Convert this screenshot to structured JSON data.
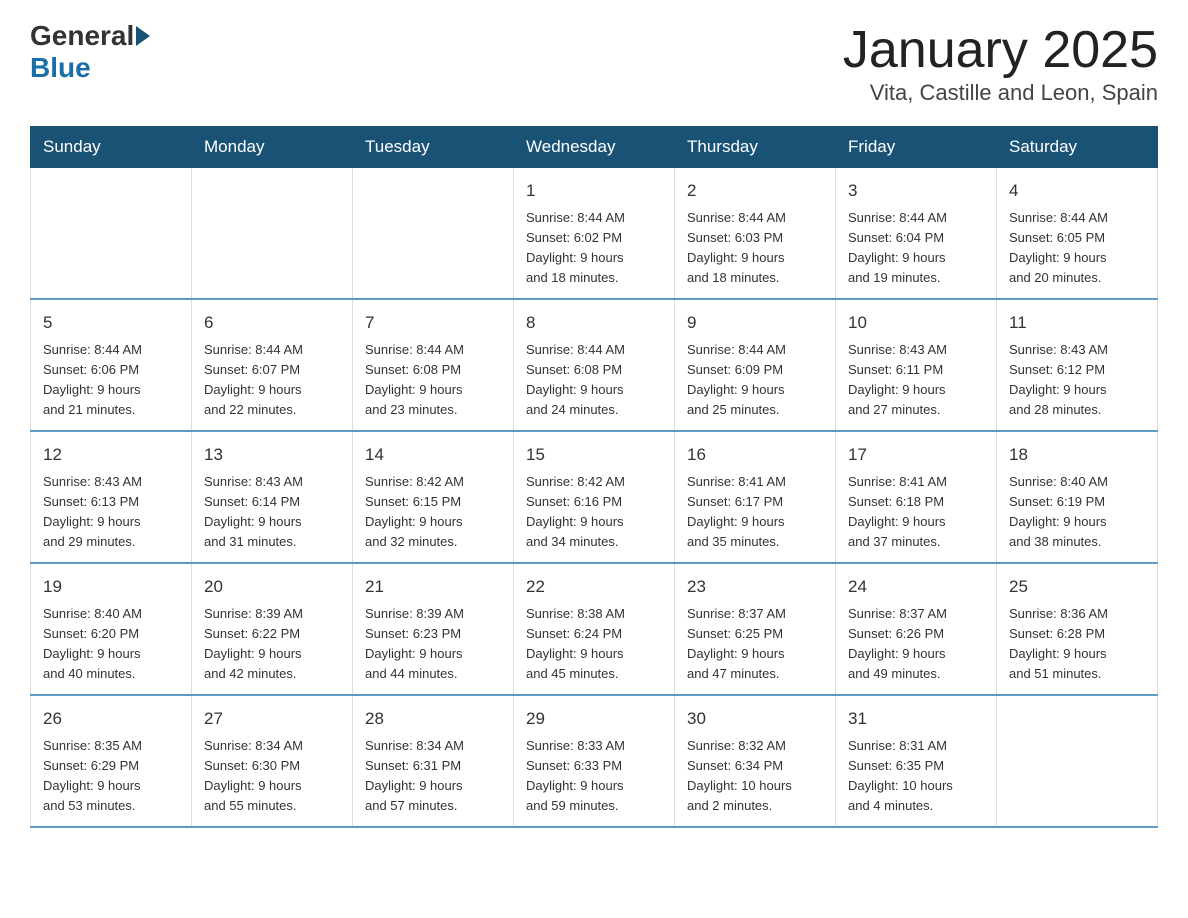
{
  "header": {
    "logo": {
      "general": "General",
      "blue": "Blue"
    },
    "title": "January 2025",
    "location": "Vita, Castille and Leon, Spain"
  },
  "weekdays": [
    "Sunday",
    "Monday",
    "Tuesday",
    "Wednesday",
    "Thursday",
    "Friday",
    "Saturday"
  ],
  "weeks": [
    [
      {
        "day": "",
        "info": ""
      },
      {
        "day": "",
        "info": ""
      },
      {
        "day": "",
        "info": ""
      },
      {
        "day": "1",
        "info": "Sunrise: 8:44 AM\nSunset: 6:02 PM\nDaylight: 9 hours\nand 18 minutes."
      },
      {
        "day": "2",
        "info": "Sunrise: 8:44 AM\nSunset: 6:03 PM\nDaylight: 9 hours\nand 18 minutes."
      },
      {
        "day": "3",
        "info": "Sunrise: 8:44 AM\nSunset: 6:04 PM\nDaylight: 9 hours\nand 19 minutes."
      },
      {
        "day": "4",
        "info": "Sunrise: 8:44 AM\nSunset: 6:05 PM\nDaylight: 9 hours\nand 20 minutes."
      }
    ],
    [
      {
        "day": "5",
        "info": "Sunrise: 8:44 AM\nSunset: 6:06 PM\nDaylight: 9 hours\nand 21 minutes."
      },
      {
        "day": "6",
        "info": "Sunrise: 8:44 AM\nSunset: 6:07 PM\nDaylight: 9 hours\nand 22 minutes."
      },
      {
        "day": "7",
        "info": "Sunrise: 8:44 AM\nSunset: 6:08 PM\nDaylight: 9 hours\nand 23 minutes."
      },
      {
        "day": "8",
        "info": "Sunrise: 8:44 AM\nSunset: 6:08 PM\nDaylight: 9 hours\nand 24 minutes."
      },
      {
        "day": "9",
        "info": "Sunrise: 8:44 AM\nSunset: 6:09 PM\nDaylight: 9 hours\nand 25 minutes."
      },
      {
        "day": "10",
        "info": "Sunrise: 8:43 AM\nSunset: 6:11 PM\nDaylight: 9 hours\nand 27 minutes."
      },
      {
        "day": "11",
        "info": "Sunrise: 8:43 AM\nSunset: 6:12 PM\nDaylight: 9 hours\nand 28 minutes."
      }
    ],
    [
      {
        "day": "12",
        "info": "Sunrise: 8:43 AM\nSunset: 6:13 PM\nDaylight: 9 hours\nand 29 minutes."
      },
      {
        "day": "13",
        "info": "Sunrise: 8:43 AM\nSunset: 6:14 PM\nDaylight: 9 hours\nand 31 minutes."
      },
      {
        "day": "14",
        "info": "Sunrise: 8:42 AM\nSunset: 6:15 PM\nDaylight: 9 hours\nand 32 minutes."
      },
      {
        "day": "15",
        "info": "Sunrise: 8:42 AM\nSunset: 6:16 PM\nDaylight: 9 hours\nand 34 minutes."
      },
      {
        "day": "16",
        "info": "Sunrise: 8:41 AM\nSunset: 6:17 PM\nDaylight: 9 hours\nand 35 minutes."
      },
      {
        "day": "17",
        "info": "Sunrise: 8:41 AM\nSunset: 6:18 PM\nDaylight: 9 hours\nand 37 minutes."
      },
      {
        "day": "18",
        "info": "Sunrise: 8:40 AM\nSunset: 6:19 PM\nDaylight: 9 hours\nand 38 minutes."
      }
    ],
    [
      {
        "day": "19",
        "info": "Sunrise: 8:40 AM\nSunset: 6:20 PM\nDaylight: 9 hours\nand 40 minutes."
      },
      {
        "day": "20",
        "info": "Sunrise: 8:39 AM\nSunset: 6:22 PM\nDaylight: 9 hours\nand 42 minutes."
      },
      {
        "day": "21",
        "info": "Sunrise: 8:39 AM\nSunset: 6:23 PM\nDaylight: 9 hours\nand 44 minutes."
      },
      {
        "day": "22",
        "info": "Sunrise: 8:38 AM\nSunset: 6:24 PM\nDaylight: 9 hours\nand 45 minutes."
      },
      {
        "day": "23",
        "info": "Sunrise: 8:37 AM\nSunset: 6:25 PM\nDaylight: 9 hours\nand 47 minutes."
      },
      {
        "day": "24",
        "info": "Sunrise: 8:37 AM\nSunset: 6:26 PM\nDaylight: 9 hours\nand 49 minutes."
      },
      {
        "day": "25",
        "info": "Sunrise: 8:36 AM\nSunset: 6:28 PM\nDaylight: 9 hours\nand 51 minutes."
      }
    ],
    [
      {
        "day": "26",
        "info": "Sunrise: 8:35 AM\nSunset: 6:29 PM\nDaylight: 9 hours\nand 53 minutes."
      },
      {
        "day": "27",
        "info": "Sunrise: 8:34 AM\nSunset: 6:30 PM\nDaylight: 9 hours\nand 55 minutes."
      },
      {
        "day": "28",
        "info": "Sunrise: 8:34 AM\nSunset: 6:31 PM\nDaylight: 9 hours\nand 57 minutes."
      },
      {
        "day": "29",
        "info": "Sunrise: 8:33 AM\nSunset: 6:33 PM\nDaylight: 9 hours\nand 59 minutes."
      },
      {
        "day": "30",
        "info": "Sunrise: 8:32 AM\nSunset: 6:34 PM\nDaylight: 10 hours\nand 2 minutes."
      },
      {
        "day": "31",
        "info": "Sunrise: 8:31 AM\nSunset: 6:35 PM\nDaylight: 10 hours\nand 4 minutes."
      },
      {
        "day": "",
        "info": ""
      }
    ]
  ]
}
